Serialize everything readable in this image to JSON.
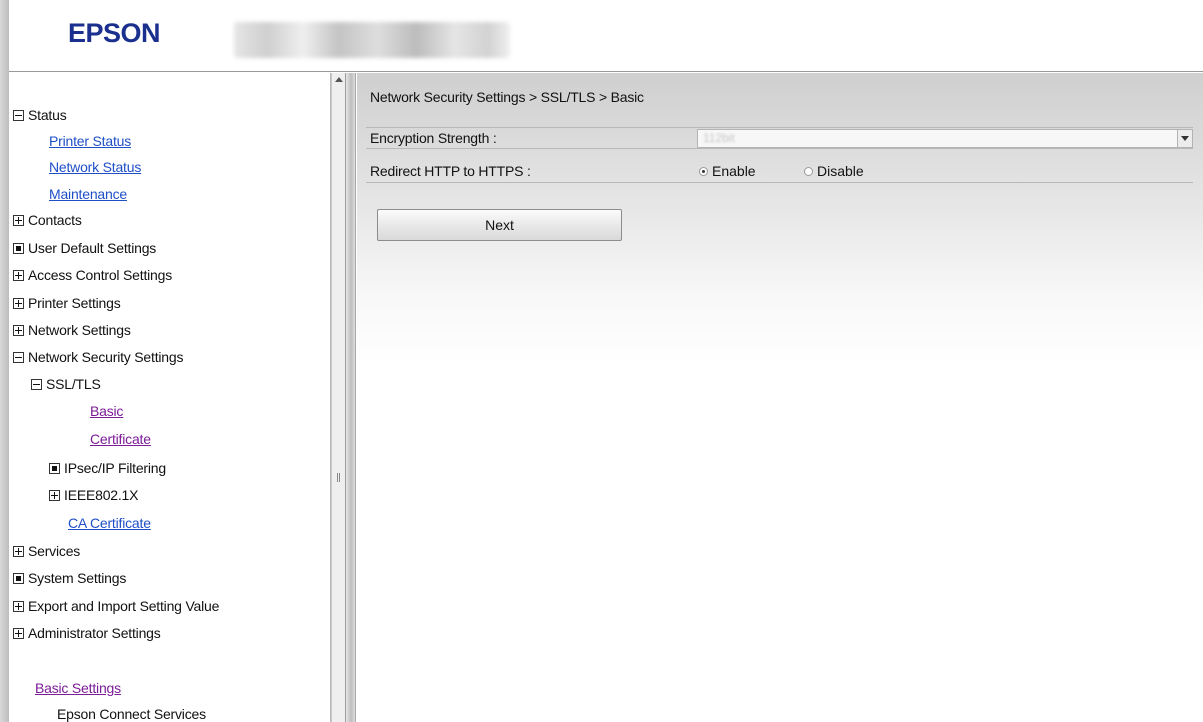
{
  "header": {
    "logo": "EPSON"
  },
  "nav": {
    "items": [
      {
        "label": "Status",
        "icon": "minus-box-icon"
      },
      {
        "label": "Printer Status",
        "icon": ""
      },
      {
        "label": "Network Status",
        "icon": ""
      },
      {
        "label": "Maintenance",
        "icon": ""
      },
      {
        "label": "Contacts",
        "icon": "plus-box-icon"
      },
      {
        "label": "User Default Settings",
        "icon": "filled-box-icon"
      },
      {
        "label": "Access Control Settings",
        "icon": "plus-box-icon"
      },
      {
        "label": "Printer Settings",
        "icon": "plus-box-icon"
      },
      {
        "label": "Network Settings",
        "icon": "plus-box-icon"
      },
      {
        "label": "Network Security Settings",
        "icon": "minus-box-icon"
      },
      {
        "label": "SSL/TLS",
        "icon": "minus-box-icon"
      },
      {
        "label": "Basic",
        "icon": ""
      },
      {
        "label": "Certificate",
        "icon": ""
      },
      {
        "label": "IPsec/IP Filtering",
        "icon": "filled-box-icon"
      },
      {
        "label": "IEEE802.1X",
        "icon": "plus-box-icon"
      },
      {
        "label": "CA Certificate",
        "icon": ""
      },
      {
        "label": "Services",
        "icon": "plus-box-icon"
      },
      {
        "label": "System Settings",
        "icon": "filled-box-icon"
      },
      {
        "label": "Export and Import Setting Value",
        "icon": "plus-box-icon"
      },
      {
        "label": "Administrator Settings",
        "icon": "plus-box-icon"
      },
      {
        "label": "Basic Settings",
        "icon": ""
      },
      {
        "label": "Epson Connect Services",
        "icon": ""
      }
    ]
  },
  "main": {
    "breadcrumb": "Network Security Settings > SSL/TLS > Basic",
    "encryption": {
      "label": "Encryption Strength :",
      "value": "112bit"
    },
    "redirect": {
      "label": "Redirect HTTP to HTTPS :",
      "enable_label": "Enable",
      "disable_label": "Disable",
      "selected": "Enable"
    },
    "next_label": "Next"
  },
  "colors": {
    "logo": "#1b2f8f",
    "link": "#1f4fc7",
    "visited_link": "#7c1c96"
  }
}
